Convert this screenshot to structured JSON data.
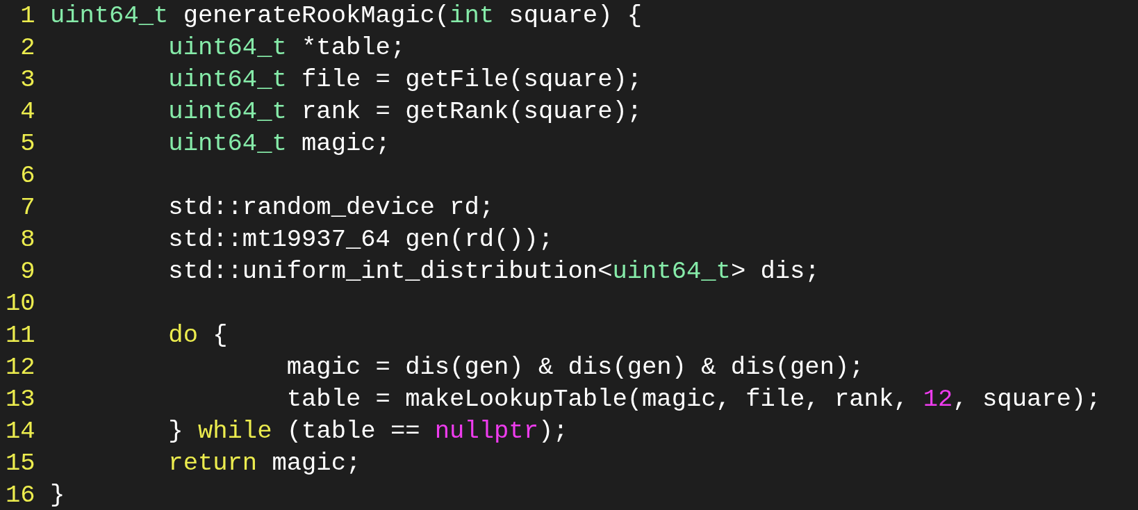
{
  "editor": {
    "lines": [
      {
        "number": "1",
        "tokens": [
          {
            "kind": "type",
            "text": "uint64_t"
          },
          {
            "kind": "plain",
            "text": " generateRookMagic("
          },
          {
            "kind": "type",
            "text": "int"
          },
          {
            "kind": "plain",
            "text": " square) {"
          }
        ]
      },
      {
        "number": "2",
        "tokens": [
          {
            "kind": "type",
            "text": "\tuint64_t"
          },
          {
            "kind": "plain",
            "text": " *table;"
          }
        ]
      },
      {
        "number": "3",
        "tokens": [
          {
            "kind": "type",
            "text": "\tuint64_t"
          },
          {
            "kind": "plain",
            "text": " file = getFile(square);"
          }
        ]
      },
      {
        "number": "4",
        "tokens": [
          {
            "kind": "type",
            "text": "\tuint64_t"
          },
          {
            "kind": "plain",
            "text": " rank = getRank(square);"
          }
        ]
      },
      {
        "number": "5",
        "tokens": [
          {
            "kind": "type",
            "text": "\tuint64_t"
          },
          {
            "kind": "plain",
            "text": " magic;"
          }
        ]
      },
      {
        "number": "6"
      },
      {
        "number": "7",
        "tokens": [
          {
            "kind": "plain",
            "text": "\tstd::random_device rd;"
          }
        ]
      },
      {
        "number": "8",
        "tokens": [
          {
            "kind": "plain",
            "text": "\tstd::mt19937_64 gen(rd());"
          }
        ]
      },
      {
        "number": "9",
        "tokens": [
          {
            "kind": "plain",
            "text": "\tstd::uniform_int_distribution<"
          },
          {
            "kind": "type",
            "text": "uint64_t"
          },
          {
            "kind": "plain",
            "text": "> dis;"
          }
        ]
      },
      {
        "number": "10"
      },
      {
        "number": "11",
        "tokens": [
          {
            "kind": "keyword",
            "text": "\tdo"
          },
          {
            "kind": "plain",
            "text": " {"
          }
        ]
      },
      {
        "number": "12",
        "tokens": [
          {
            "kind": "plain",
            "text": "\t\tmagic = dis(gen) & dis(gen) & dis(gen);"
          }
        ]
      },
      {
        "number": "13",
        "tokens": [
          {
            "kind": "plain",
            "text": "\t\ttable = makeLookupTable(magic, file, rank, "
          },
          {
            "kind": "constant",
            "text": "12"
          },
          {
            "kind": "plain",
            "text": ", square);"
          }
        ]
      },
      {
        "number": "14",
        "tokens": [
          {
            "kind": "plain",
            "text": "\t} "
          },
          {
            "kind": "keyword",
            "text": "while"
          },
          {
            "kind": "plain",
            "text": " (table == "
          },
          {
            "kind": "constant",
            "text": "nullptr"
          },
          {
            "kind": "plain",
            "text": ");"
          }
        ]
      },
      {
        "number": "15",
        "tokens": [
          {
            "kind": "keyword",
            "text": "\treturn"
          },
          {
            "kind": "plain",
            "text": " magic;"
          }
        ]
      },
      {
        "number": "16",
        "tokens": [
          {
            "kind": "plain",
            "text": "}"
          }
        ]
      }
    ]
  }
}
